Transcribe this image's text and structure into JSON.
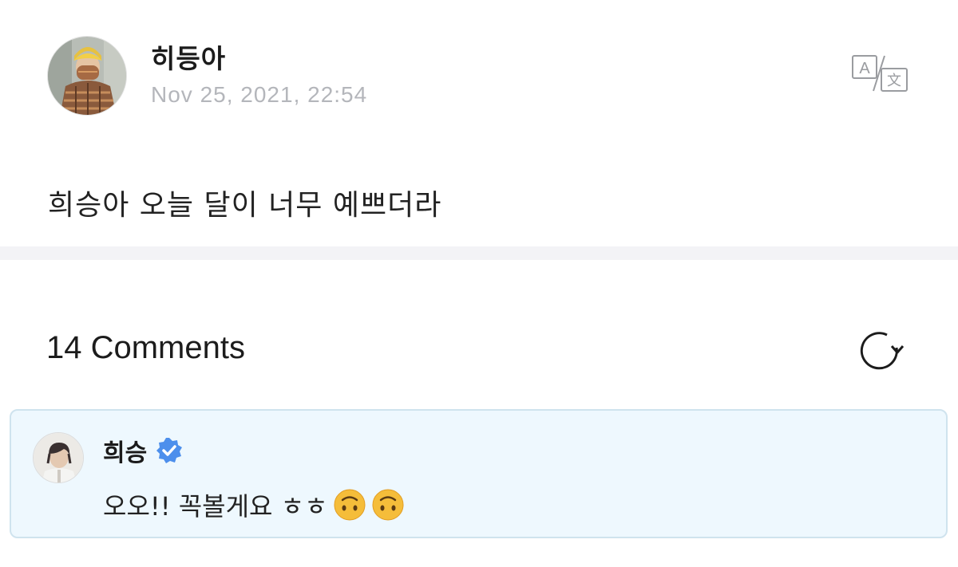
{
  "post": {
    "author": "히등아",
    "timestamp": "Nov 25, 2021, 22:54",
    "body": "희승아 오늘 달이 너무 예쁘더라",
    "translate_icon": "translate-icon"
  },
  "comments": {
    "title": "14 Comments",
    "refresh_icon": "refresh-icon",
    "items": [
      {
        "author": "희승",
        "verified": true,
        "text": "오오!! 꼭볼게요 ㅎㅎ",
        "emojis": [
          "upside-down-face",
          "upside-down-face"
        ]
      }
    ]
  },
  "colors": {
    "timestamp": "#b4b6bb",
    "divider": "#f3f3f6",
    "comment_bg": "#eef8fe",
    "comment_border": "#cfe3ee",
    "verified": "#4d8fec",
    "emoji": "#f5bd3a"
  }
}
